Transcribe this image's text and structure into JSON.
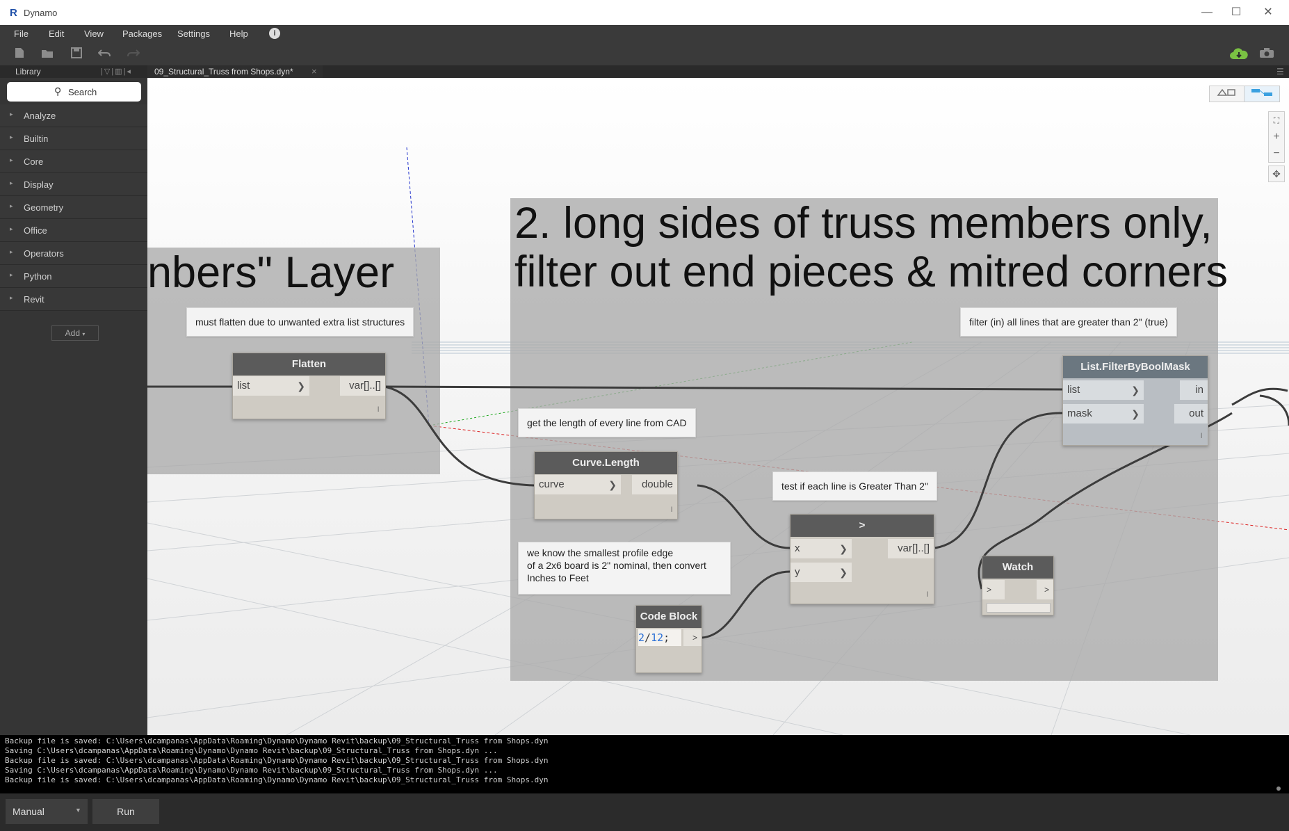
{
  "app": {
    "title": "Dynamo",
    "logo": "R"
  },
  "window": {
    "min": "—",
    "max": "☐",
    "close": "✕"
  },
  "menu": [
    "File",
    "Edit",
    "View",
    "Packages",
    "Settings",
    "Help",
    "i"
  ],
  "library": {
    "title": "Library",
    "search_label": "Search",
    "categories": [
      "Analyze",
      "Builtin",
      "Core",
      "Display",
      "Geometry",
      "Office",
      "Operators",
      "Python",
      "Revit"
    ],
    "add_label": "Add"
  },
  "tab": {
    "label": "09_Structural_Truss from Shops.dyn*",
    "close": "×"
  },
  "groups": {
    "left_title": "nbers\" Layer",
    "right_title_line1": "2. long sides of truss members only,",
    "right_title_line2": "filter out end pieces & mitred corners"
  },
  "notes": {
    "flatten_note": "must flatten due to unwanted extra list structures",
    "filter_note": "filter (in) all lines that are greater than 2\" (true)",
    "length_note": "get the length of every line from CAD",
    "greater_note": "test if each line is Greater Than 2\"",
    "profile_note_1": "we know the smallest profile edge",
    "profile_note_2": "of a 2x6 board is 2\" nominal, then convert",
    "profile_note_3": "Inches to Feet"
  },
  "nodes": {
    "flatten": {
      "title": "Flatten",
      "in": "list",
      "out": "var[]..[]",
      "lace": "l"
    },
    "curve_length": {
      "title": "Curve.Length",
      "in": "curve",
      "out": "double",
      "lace": "l"
    },
    "greater": {
      "title": ">",
      "in_x": "x",
      "in_y": "y",
      "out": "var[]..[]",
      "lace": "l"
    },
    "code_block": {
      "title": "Code Block",
      "code_a": "2",
      "code_slash": "/",
      "code_b": "12",
      "code_end": ";",
      "out": ">"
    },
    "filter": {
      "title": "List.FilterByBoolMask",
      "in_list": "list",
      "in_mask": "mask",
      "out_in": "in",
      "out_out": "out",
      "lace": "l"
    },
    "watch": {
      "title": "Watch",
      "in": ">",
      "out": ">"
    }
  },
  "console": [
    "Backup file is saved: C:\\Users\\dcampanas\\AppData\\Roaming\\Dynamo\\Dynamo Revit\\backup\\09_Structural_Truss from Shops.dyn",
    "Saving C:\\Users\\dcampanas\\AppData\\Roaming\\Dynamo\\Dynamo Revit\\backup\\09_Structural_Truss from Shops.dyn ...",
    "Backup file is saved: C:\\Users\\dcampanas\\AppData\\Roaming\\Dynamo\\Dynamo Revit\\backup\\09_Structural_Truss from Shops.dyn",
    "Saving C:\\Users\\dcampanas\\AppData\\Roaming\\Dynamo\\Dynamo Revit\\backup\\09_Structural_Truss from Shops.dyn ...",
    "Backup file is saved: C:\\Users\\dcampanas\\AppData\\Roaming\\Dynamo\\Dynamo Revit\\backup\\09_Structural_Truss from Shops.dyn"
  ],
  "run": {
    "mode": "Manual",
    "button": "Run"
  },
  "colors": {
    "accent_green": "#7ac143",
    "code_number": "#2a6fd6"
  }
}
